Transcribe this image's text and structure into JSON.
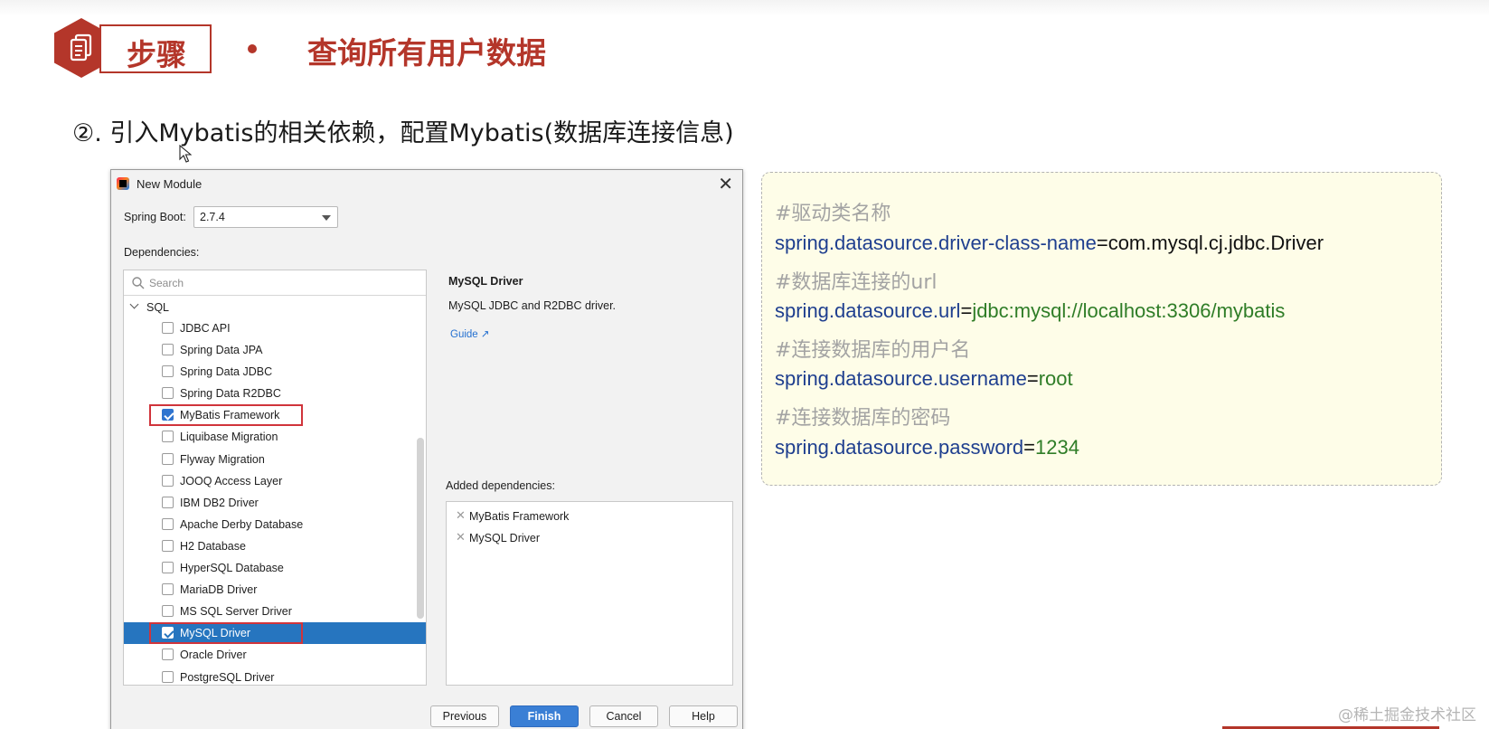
{
  "slide": {
    "step_label": "步骤",
    "title": "查询所有用户数据",
    "subtitle": "②. 引入Mybatis的相关依赖，配置Mybatis(数据库连接信息)"
  },
  "dialog": {
    "title": "New Module",
    "spring_boot_label": "Spring Boot:",
    "spring_boot_version": "2.7.4",
    "dependencies_label": "Dependencies:",
    "search_placeholder": "Search",
    "group": "SQL",
    "items": [
      {
        "label": "JDBC API",
        "checked": false
      },
      {
        "label": "Spring Data JPA",
        "checked": false
      },
      {
        "label": "Spring Data JDBC",
        "checked": false
      },
      {
        "label": "Spring Data R2DBC",
        "checked": false
      },
      {
        "label": "MyBatis Framework",
        "checked": true
      },
      {
        "label": "Liquibase Migration",
        "checked": false
      },
      {
        "label": "Flyway Migration",
        "checked": false
      },
      {
        "label": "JOOQ Access Layer",
        "checked": false
      },
      {
        "label": "IBM DB2 Driver",
        "checked": false
      },
      {
        "label": "Apache Derby Database",
        "checked": false
      },
      {
        "label": "H2 Database",
        "checked": false
      },
      {
        "label": "HyperSQL Database",
        "checked": false
      },
      {
        "label": "MariaDB Driver",
        "checked": false
      },
      {
        "label": "MS SQL Server Driver",
        "checked": false
      },
      {
        "label": "MySQL Driver",
        "checked": true
      },
      {
        "label": "Oracle Driver",
        "checked": false
      },
      {
        "label": "PostgreSQL Driver",
        "checked": false
      }
    ],
    "info_title": "MySQL Driver",
    "info_desc": "MySQL JDBC and R2DBC driver.",
    "guide_link": "Guide ↗",
    "added_label": "Added dependencies:",
    "added": [
      "MyBatis Framework",
      "MySQL Driver"
    ],
    "buttons": {
      "previous": "Previous",
      "finish": "Finish",
      "cancel": "Cancel",
      "help": "Help"
    }
  },
  "config": {
    "driver_comment": "#驱动类名称",
    "driver_key": "spring.datasource.driver-class-name",
    "driver_value": "com.mysql.cj.jdbc.Driver",
    "url_comment": "#数据库连接的url",
    "url_key": "spring.datasource.url",
    "url_value": "jdbc:mysql://localhost:3306/mybatis",
    "user_comment": "#连接数据库的用户名",
    "user_key": "spring.datasource.username",
    "user_value": "root",
    "pass_comment": "#连接数据库的密码",
    "pass_key": "spring.datasource.password",
    "pass_value": "1234",
    "equals": "="
  },
  "watermark": "@稀土掘金技术社区",
  "colors": {
    "accent_red": "#b4362a",
    "selection_blue": "#2675bf",
    "config_key": "#1f3f8f",
    "config_value_green": "#2f7d27",
    "config_bg": "#fefde8"
  }
}
